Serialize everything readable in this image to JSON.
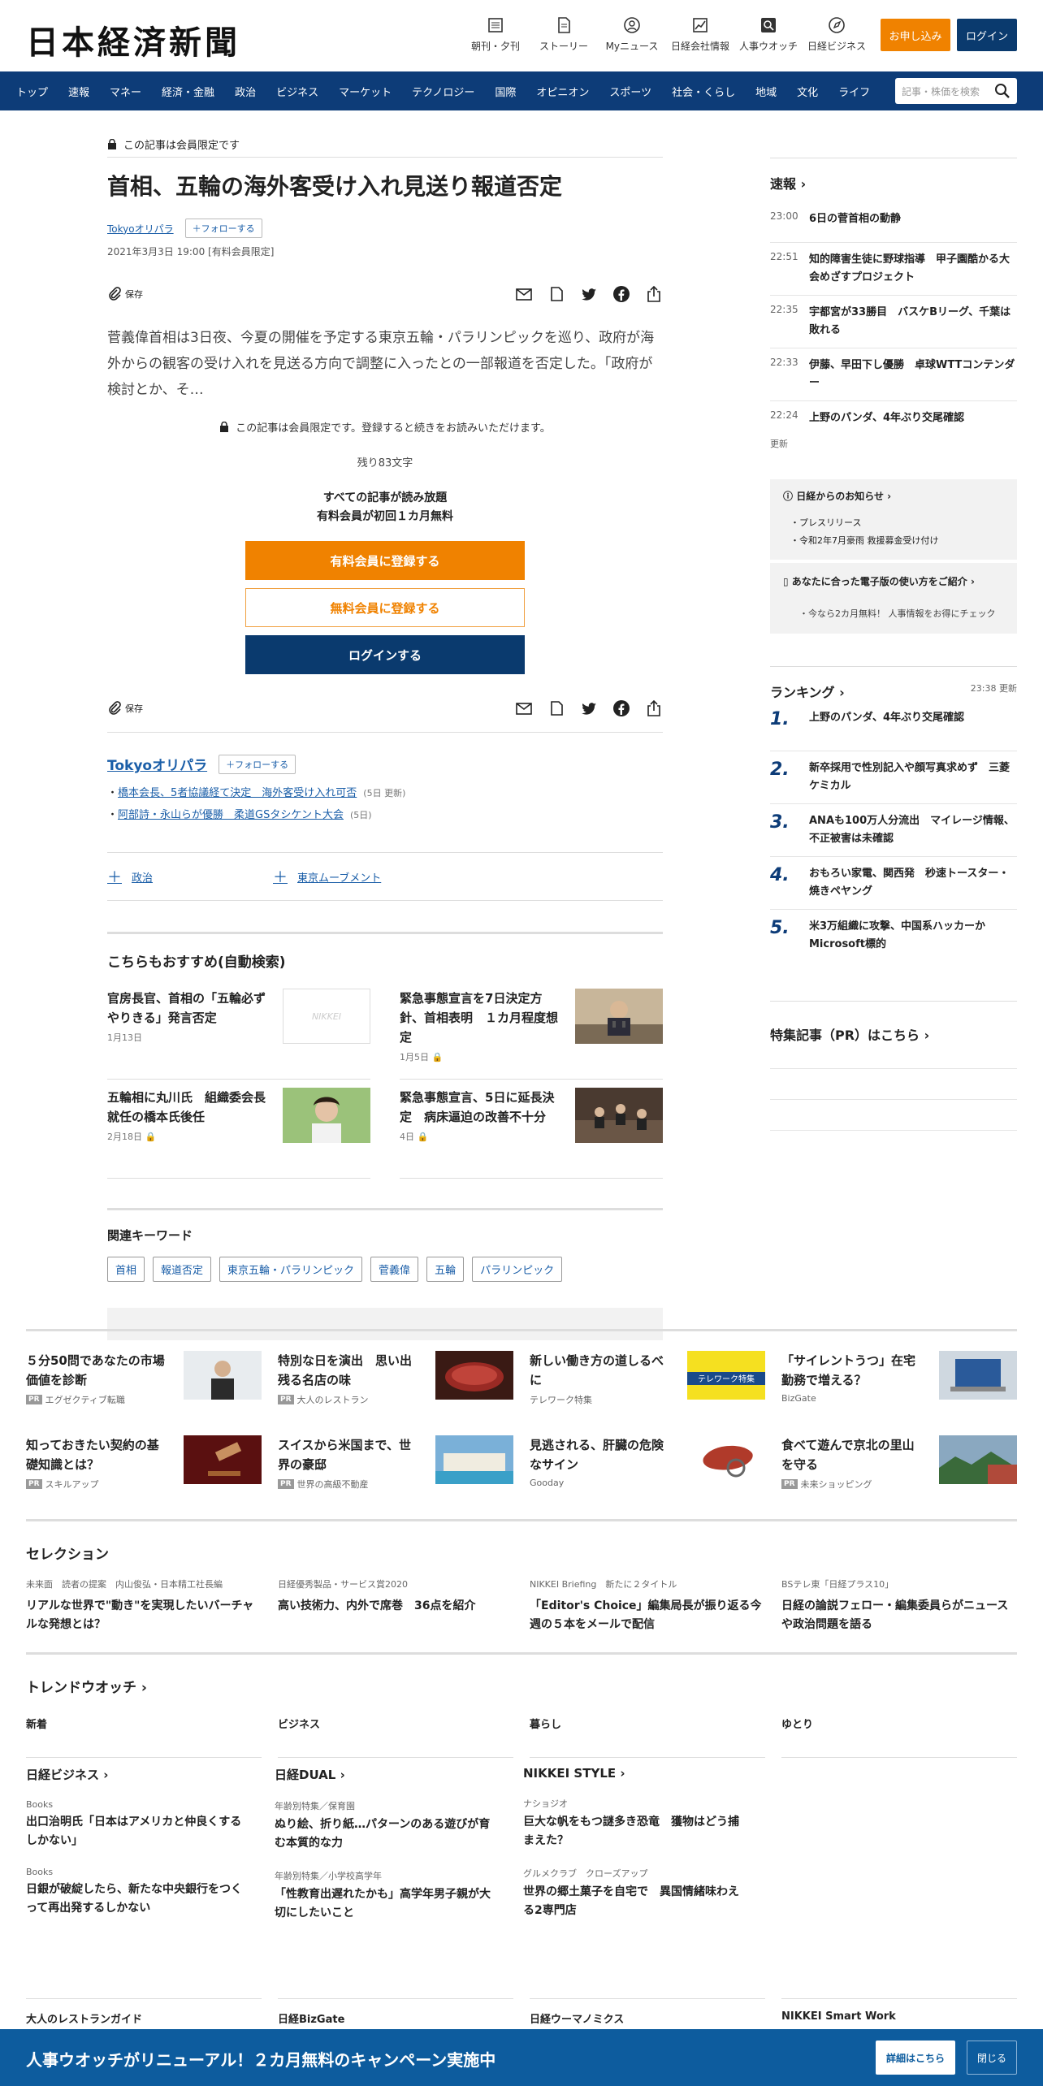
{
  "header": {
    "logo": "日本経済新聞",
    "tools": [
      "朝刊・夕刊",
      "ストーリー",
      "Myニュース",
      "日経会社情報",
      "人事ウオッチ",
      "日経ビジネス"
    ],
    "apply": "お申し込み",
    "login": "ログイン"
  },
  "nav": {
    "items": [
      "トップ",
      "速報",
      "マネー",
      "経済・金融",
      "政治",
      "ビジネス",
      "マーケット",
      "テクノロジー",
      "国際",
      "オピニオン",
      "スポーツ",
      "社会・くらし",
      "地域",
      "文化",
      "ライフ"
    ],
    "search_placeholder": "記事・株価を検索"
  },
  "article": {
    "member_only": "この記事は会員限定です",
    "title": "首相、五輪の海外客受け入れ見送り報道否定",
    "author": "Tokyoオリパラ",
    "follow": "フォローする",
    "date": "2021年3月3日 19:00 [有料会員限定]",
    "save": "保存",
    "lead": "菅義偉首相は3日夜、今夏の開催を予定する東京五輪・パラリンピックを巡り、政府が海外からの観客の受け入れを見送る方向で調整に入ったとの一部報道を否定した。「政府が検討とか、そ…",
    "paywall_note": "この記事は会員限定です。登録すると続きをお読みいただけます。",
    "remaining": "残り83文字",
    "benefit1": "すべての記事が読み放題",
    "benefit2": "有料会員が初回１カ月無料",
    "btn_paid": "有料会員に登録する",
    "btn_free": "無料会員に登録する",
    "btn_login": "ログインする"
  },
  "author_box": {
    "name": "Tokyoオリパラ",
    "follow": "フォローする",
    "related": [
      {
        "title": "橋本会長、5者協議経て決定　海外客受け入れ可否",
        "update": "(5日 更新)"
      },
      {
        "title": "阿部詩・永山らが優勝　柔道GSタシケント大会",
        "update": "(5日)"
      }
    ]
  },
  "topics": [
    "政治",
    "東京ムーブメント"
  ],
  "recommend": {
    "title": "こちらもおすすめ(自動検索)",
    "items": [
      {
        "title": "官房長官、首相の「五輪必ずやりきる」発言否定",
        "date": "1月13日"
      },
      {
        "title": "緊急事態宣言を7日決定方針、首相表明　１カ月程度想定",
        "date": "1月5日"
      },
      {
        "title": "五輪相に丸川氏　組織委会長就任の橋本氏後任",
        "date": "2月18日"
      },
      {
        "title": "緊急事態宣言、5日に延長決定　病床逼迫の改善不十分",
        "date": "4日"
      }
    ],
    "placeholder_logo": "NIKKEI"
  },
  "keywords": {
    "title": "関連キーワード",
    "items": [
      "首相",
      "報道否定",
      "東京五輪・パラリンピック",
      "菅義偉",
      "五輪",
      "パラリンピック"
    ]
  },
  "sidebar": {
    "flash_title": "速報",
    "flash": [
      {
        "time": "23:00",
        "text": "6日の菅首相の動静"
      },
      {
        "time": "22:51",
        "text": "知的障害生徒に野球指導　甲子園酷かる大会めざすプロジェクト"
      },
      {
        "time": "22:35",
        "text": "宇都宮が33勝目　バスケBリーグ、千葉は敗れる"
      },
      {
        "time": "22:33",
        "text": "伊藤、早田下し優勝　卓球WTTコンテンダー"
      },
      {
        "time": "22:24",
        "text": "上野のパンダ、4年ぶり交尾確認"
      }
    ],
    "more": "更新",
    "notice_title": "日経からのお知らせ",
    "notice_items": [
      "プレスリリース",
      "令和2年7月豪雨 救援募金受け付け"
    ],
    "notice2_title": "あなたに合った電子版の使い方をご紹介",
    "notice2_text": "・今なら2カ月無料！ 人事情報をお得にチェック",
    "ranking_title": "ランキング",
    "ranking_time": "23:38 更新",
    "ranking": [
      {
        "n": "1.",
        "text": "上野のパンダ、4年ぶり交尾確認"
      },
      {
        "n": "2.",
        "text": "新卒採用で性別記入や顔写真求めず　三菱ケミカル"
      },
      {
        "n": "3.",
        "text": "ANAも100万人分流出　マイレージ情報、不正被害は未確認"
      },
      {
        "n": "4.",
        "text": "おもろい家電、関西発　秒速トースター・焼きペヤング"
      },
      {
        "n": "5.",
        "text": "米3万組織に攻撃、中国系ハッカーかMicrosoft標的"
      }
    ],
    "pr_title": "特集記事（PR）はこちら"
  },
  "promo": [
    {
      "title": "５分50問であなたの市場価値を診断",
      "src": "エグゼクティブ転職",
      "pr": true
    },
    {
      "title": "特別な日を演出　思い出残る名店の味",
      "src": "大人のレストラン",
      "pr": true
    },
    {
      "title": "新しい働き方の道しるべに",
      "src": "テレワーク特集",
      "pr": false
    },
    {
      "title": "「サイレントうつ」在宅勤務で増える？",
      "src": "BizGate",
      "pr": false
    },
    {
      "title": "知っておきたい契約の基礎知識とは？",
      "src": "スキルアップ",
      "pr": true
    },
    {
      "title": "スイスから米国まで、世界の豪邸",
      "src": "世界の高級不動産",
      "pr": true
    },
    {
      "title": "見逃される、肝臓の危険なサイン",
      "src": "Gooday",
      "pr": false
    },
    {
      "title": "食べて遊んで京北の里山を守る",
      "src": "未来ショッピング",
      "pr": true
    }
  ],
  "pr_badge": "PR",
  "promo_banner_text": "テレワーク特集",
  "selection": {
    "title": "セレクション",
    "items": [
      {
        "kicker": "未来面　読者の提案　内山俊弘・日本精工社長編",
        "title": "リアルな世界で\"動き\"を実現したいバーチャルな発想とは？"
      },
      {
        "kicker": "日経優秀製品・サービス賞2020",
        "title": "高い技術力、内外で席巻　36点を紹介"
      },
      {
        "kicker": "NIKKEI Briefing　新たに２タイトル",
        "title": "「Editor's Choice」編集局長が振り返る今週の５本をメールで配信"
      },
      {
        "kicker": "BSテレ東「日経プラス10」",
        "title": "日経の論説フェロー・編集委員らがニュースや政治問題を語る"
      }
    ]
  },
  "trend": {
    "title": "トレンドウオッチ",
    "tabs": [
      "新着",
      "ビジネス",
      "暮らし",
      "ゆとり"
    ]
  },
  "media": [
    {
      "name": "日経ビジネス",
      "items": [
        {
          "kicker": "Books",
          "title": "出口治明氏「日本はアメリカと仲良くするしかない」"
        },
        {
          "kicker": "Books",
          "title": "日銀が破綻したら、新たな中央銀行をつくって再出発するしかない"
        }
      ]
    },
    {
      "name": "日経DUAL",
      "items": [
        {
          "kicker": "年齢別特集／保育園",
          "title": "ぬり絵、折り紙…パターンのある遊びが育む本質的な力"
        },
        {
          "kicker": "年齢別特集／小学校高学年",
          "title": "「性教育出遅れたかも」高学年男子親が大切にしたいこと"
        }
      ]
    },
    {
      "name": "NIKKEI STYLE",
      "items": [
        {
          "kicker": "ナショジオ",
          "title": "巨大な帆をもつ謎多き恐竜　獲物はどう捕まえた？"
        },
        {
          "kicker": "グルメクラブ　クローズアップ",
          "title": "世界の郷土菓子を自宅で　異国情緒味わえる2専門店"
        }
      ]
    }
  ],
  "foot_tabs": [
    "大人のレストランガイド",
    "日経BizGate",
    "日経ウーマノミクス",
    "NIKKEI Smart Work"
  ],
  "banner": {
    "message": "人事ウオッチがリニューアル！２カ月無料のキャンペーン実施中",
    "detail": "詳細はこちら",
    "close": "閉じる"
  }
}
